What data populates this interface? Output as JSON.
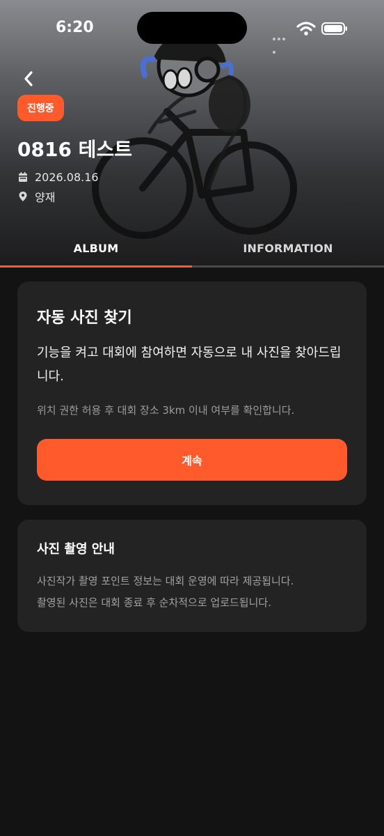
{
  "status_bar": {
    "time": "6:20"
  },
  "event": {
    "status_badge": "진행중",
    "title": "0816 테스트",
    "date": "2026.08.16",
    "location": "양재"
  },
  "tabs": [
    {
      "label": "ALBUM",
      "active": true
    },
    {
      "label": "INFORMATION",
      "active": false
    }
  ],
  "auto_find_card": {
    "title": "자동 사진 찾기",
    "description": "기능을 켜고 대회에 참여하면 자동으로 내 사진을 찾아드립니다.",
    "note": "위치 권한 허용 후 대회 장소 3km 이내 여부를 확인합니다.",
    "button_label": "계속"
  },
  "photo_guide_card": {
    "title": "사진 촬영 안내",
    "lines": [
      "사진작가 촬영 포인트 정보는 대회 운영에 따라 제공됩니다.",
      "촬영된 사진은 대회 종료 후 순차적으로 업로드됩니다."
    ]
  },
  "icons": {
    "back": "chevron-left-icon",
    "date": "calendar-icon",
    "location": "location-pin-icon"
  },
  "colors": {
    "accent": "#ff5a2c",
    "background": "#131313",
    "card": "#232323"
  }
}
